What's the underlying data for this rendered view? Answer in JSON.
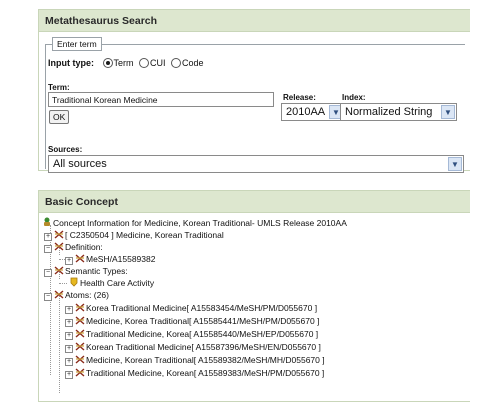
{
  "search": {
    "title": "Metathesaurus Search",
    "legend": "Enter term",
    "input_type_label": "Input type:",
    "input_types": [
      {
        "label": "Term",
        "selected": true
      },
      {
        "label": "CUI",
        "selected": false
      },
      {
        "label": "Code",
        "selected": false
      }
    ],
    "term_label": "Term:",
    "term_value": "Traditional Korean Medicine",
    "ok_label": "OK",
    "release_label": "Release:",
    "release_value": "2010AA",
    "index_label": "Index:",
    "index_value": "Normalized String",
    "sources_label": "Sources:",
    "sources_value": "All sources"
  },
  "concept": {
    "title": "Basic Concept",
    "header_line": "Concept Information for Medicine, Korean Traditional- UMLS Release 2010AA",
    "cui_line": "[ C2350504 ] Medicine, Korean Traditional",
    "definition_label": "Definition:",
    "definition_item": "MeSH/A15589382",
    "semantic_types_label": "Semantic Types:",
    "semantic_type_item": "Health Care Activity",
    "atoms_label": "Atoms: (26)",
    "atoms": [
      "Korea Traditional Medicine[ A15583454/MeSH/PM/D055670 ]",
      "Medicine, Korea Traditional[ A15585441/MeSH/PM/D055670 ]",
      "Traditional Medicine, Korea[ A15585440/MeSH/EP/D055670 ]",
      "Korean Traditional Medicine[ A15587396/MeSH/EN/D055670 ]",
      "Medicine, Korean Traditional[ A15589382/MeSH/MH/D055670 ]",
      "Traditional Medicine, Korean[ A15589383/MeSH/PM/D055670 ]"
    ]
  },
  "colors": {
    "panel_header_bg": "#dde7cf",
    "panel_border": "#c9d6b9"
  }
}
